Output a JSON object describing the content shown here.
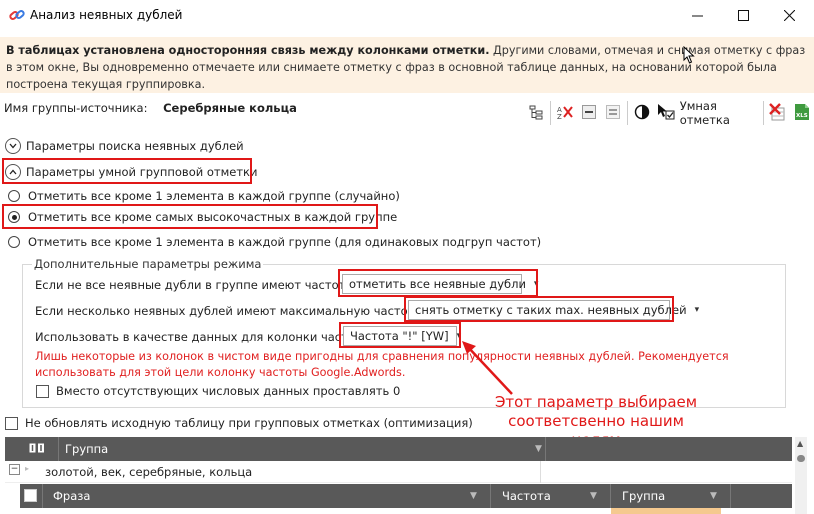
{
  "window": {
    "title": "Анализ неявных дублей"
  },
  "banner": {
    "bold_text": "В таблицах установлена односторонняя связь между колонками отметки.",
    "text": " Другими словами, отмечая и снимая отметку с фраз в этом окне, Вы одновременно отмечаете или снимаете отметку с фраз в основной таблице данных, на основании которой была построена текущая группировка."
  },
  "source_group": {
    "label": "Имя группы-источника:",
    "value": "Серебряные кольца"
  },
  "toolbar": {
    "smart_mark_label": "Умная отметка"
  },
  "sections": {
    "search_params": "Параметры поиска неявных дублей",
    "smart_params": "Параметры умной групповой отметки"
  },
  "radios": [
    {
      "label": "Отметить все кроме 1 элемента в каждой группе (случайно)",
      "selected": false
    },
    {
      "label": "Отметить все кроме самых высокочастных в каждой группе",
      "selected": true
    },
    {
      "label": "Отметить все кроме 1 элемента в каждой группе (для одинаковых подгруп частот)",
      "selected": false
    }
  ],
  "extra": {
    "legend": "Дополнительные параметры режима",
    "row1_label": "Если не все неявные дубли в группе имеют частоту, то",
    "row1_value": "отметить все неявные дубли",
    "row2_label": "Если несколько неявных дублей имеют максимальную частоту, то",
    "row2_value": "снять отметку с таких max. неявных дублей",
    "row3_label": "Использовать в качестве данных для колонки частоты:",
    "row3_value": "Частота \"!\" [YW]",
    "warning": "Лишь некоторые из колонок в чистом виде пригодны для сравнения популярности неявных дублей. Рекомендуется использовать для этой цели колонку частоты Google.Adwords.",
    "zero_checkbox": "Вместо отсутствующих числовых данных проставлять 0"
  },
  "no_update_checkbox": "Не обновлять исходную таблицу при групповых отметках (оптимизация)",
  "annotation": {
    "line1": "Этот параметр выбираем",
    "line2": "соответсвенно нашим целям"
  },
  "grid": {
    "col_group": "Группа",
    "row1_text": "золотой, век, серебряные, кольца",
    "col_phrase": "Фраза",
    "col_freq": "Частота",
    "col_group2": "Группа"
  },
  "colors": {
    "highlight_red": "#e01818",
    "banner_bg": "#fdf1e2",
    "grid_header": "#595959"
  }
}
